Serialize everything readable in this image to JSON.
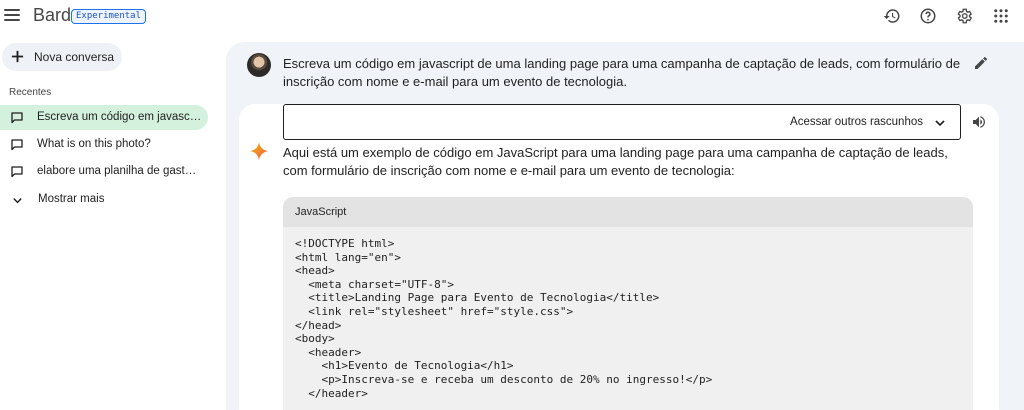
{
  "header": {
    "brand": "Bard",
    "badge": "Experimental",
    "icons": [
      "history-icon",
      "help-icon",
      "settings-icon",
      "apps-icon"
    ]
  },
  "sidebar": {
    "new_chat_label": "Nova conversa",
    "recent_title": "Recentes",
    "items": [
      {
        "label": "Escreva um código em javascript de uma landing page",
        "active": true
      },
      {
        "label": "What is on this photo?",
        "active": false
      },
      {
        "label": "elabore uma planilha de gastos mensais",
        "active": false
      }
    ],
    "show_more_label": "Mostrar mais"
  },
  "conversation": {
    "prompt": "Escreva um código em javascript de uma landing page para uma campanha de captação de leads, com formulário de inscrição com nome e e-mail para um evento de tecnologia.",
    "drafts_label": "Acessar outros rascunhos",
    "answer": "Aqui está um exemplo de código em JavaScript para uma landing page para uma campanha de captação de leads, com formulário de inscrição com nome e e-mail para um evento de tecnologia:",
    "code_language": "JavaScript",
    "code_lines": [
      "<!DOCTYPE html>",
      "<html lang=\"en\">",
      "<head>",
      "  <meta charset=\"UTF-8\">",
      "  <title>Landing Page para Evento de Tecnologia</title>",
      "  <link rel=\"stylesheet\" href=\"style.css\">",
      "</head>",
      "<body>",
      "  <header>",
      "    <h1>Evento de Tecnologia</h1>",
      "    <p>Inscreva-se e receba um desconto de 20% no ingresso!</p>",
      "  </header>"
    ]
  },
  "colors": {
    "accent": "#1a73e8",
    "active_item_bg": "#d3f1dd",
    "main_bg": "#f0f4f9",
    "code_bg": "#f0f0f0",
    "code_header_bg": "#e3e3e3"
  }
}
